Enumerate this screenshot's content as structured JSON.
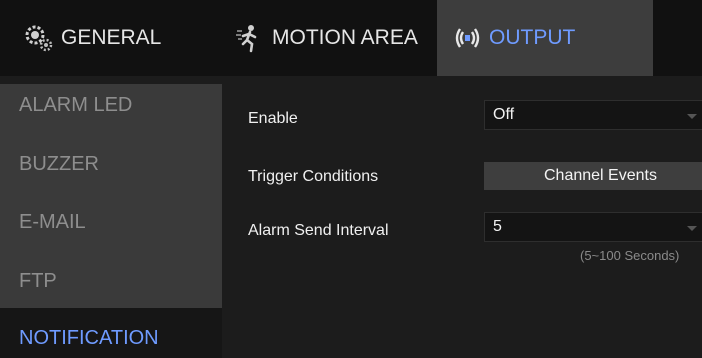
{
  "tabs": {
    "general": {
      "label": "GENERAL",
      "icon": "gears-icon"
    },
    "motion_area": {
      "label": "MOTION AREA",
      "icon": "running-person-icon"
    },
    "output": {
      "label": "OUTPUT",
      "icon": "broadcast-signal-icon",
      "active": true
    }
  },
  "sidebar": {
    "items": [
      {
        "label": "ALARM LED"
      },
      {
        "label": "BUZZER"
      },
      {
        "label": "E-MAIL"
      },
      {
        "label": "FTP"
      },
      {
        "label": "NOTIFICATION",
        "active": true
      }
    ]
  },
  "form": {
    "enable": {
      "label": "Enable",
      "value": "Off"
    },
    "trigger": {
      "label": "Trigger Conditions",
      "button": "Channel Events"
    },
    "interval": {
      "label": "Alarm Send Interval",
      "value": "5",
      "hint": "(5~100 Seconds)"
    }
  },
  "colors": {
    "accent": "#6f9bff",
    "background": "#1c1c1c",
    "panel": "#3a3a3a"
  }
}
